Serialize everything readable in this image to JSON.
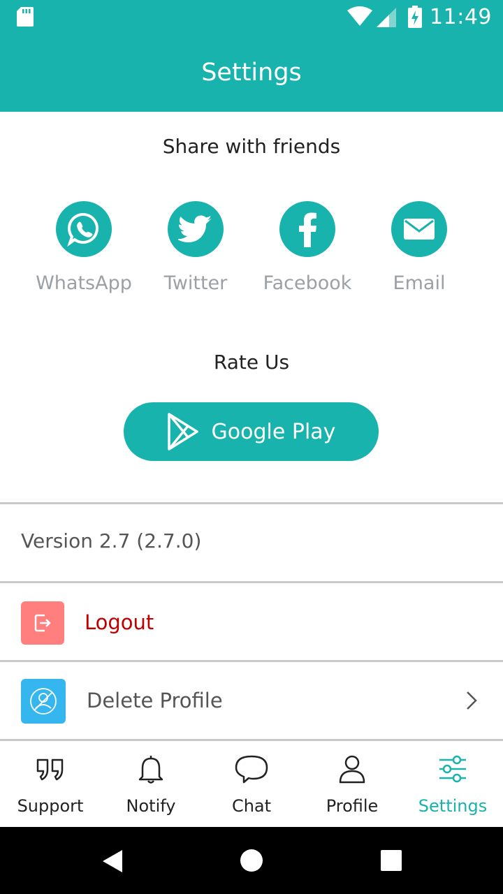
{
  "status_bar": {
    "time": "11:49"
  },
  "app_bar": {
    "title": "Settings"
  },
  "share": {
    "title": "Share with friends",
    "items": [
      {
        "label": "WhatsApp",
        "icon": "whatsapp-icon"
      },
      {
        "label": "Twitter",
        "icon": "twitter-icon"
      },
      {
        "label": "Facebook",
        "icon": "facebook-icon"
      },
      {
        "label": "Email",
        "icon": "email-icon"
      }
    ]
  },
  "rate": {
    "title": "Rate Us",
    "button_label": "Google Play"
  },
  "version_text": "Version 2.7 (2.7.0)",
  "logout": {
    "label": "Logout",
    "color": "#c00000",
    "icon_color": "#ff7f7f"
  },
  "delete_profile": {
    "label": "Delete Profile",
    "icon_color": "#35b6ef"
  },
  "bottom_nav": {
    "items": [
      {
        "label": "Support",
        "icon": "quote-icon"
      },
      {
        "label": "Notify",
        "icon": "bell-icon"
      },
      {
        "label": "Chat",
        "icon": "chat-bubble-icon"
      },
      {
        "label": "Profile",
        "icon": "person-icon"
      },
      {
        "label": "Settings",
        "icon": "sliders-icon",
        "active": true
      }
    ]
  },
  "colors": {
    "primary": "#18b3ac",
    "divider": "#c9c9c9",
    "muted_text": "#9aa0a6"
  }
}
